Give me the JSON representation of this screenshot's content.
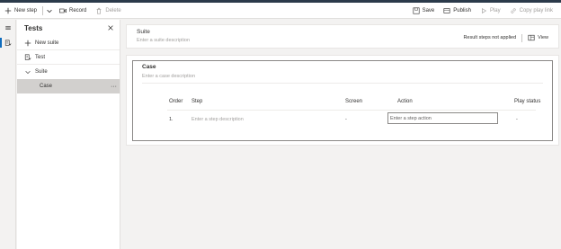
{
  "toolbar": {
    "new_step": "New step",
    "record": "Record",
    "delete": "Delete",
    "save": "Save",
    "publish": "Publish",
    "play": "Play",
    "copy_play_link": "Copy play link"
  },
  "tree": {
    "title": "Tests",
    "new_suite": "New suite",
    "test_item": "Test",
    "suite_item": "Suite",
    "case_item": "Case",
    "more": "···"
  },
  "suite": {
    "name": "Suite",
    "description_placeholder": "Enter a suite description",
    "status": "Result steps not applied",
    "view": "View"
  },
  "case": {
    "name": "Case",
    "description_placeholder": "Enter a case description",
    "columns": {
      "order": "Order",
      "step": "Step",
      "screen": "Screen",
      "action": "Action",
      "play_status": "Play status"
    },
    "rows": [
      {
        "order": "1.",
        "step_placeholder": "Enter a step description",
        "screen": "-",
        "action_placeholder": "Enter a step action",
        "play_status": "-"
      }
    ]
  }
}
